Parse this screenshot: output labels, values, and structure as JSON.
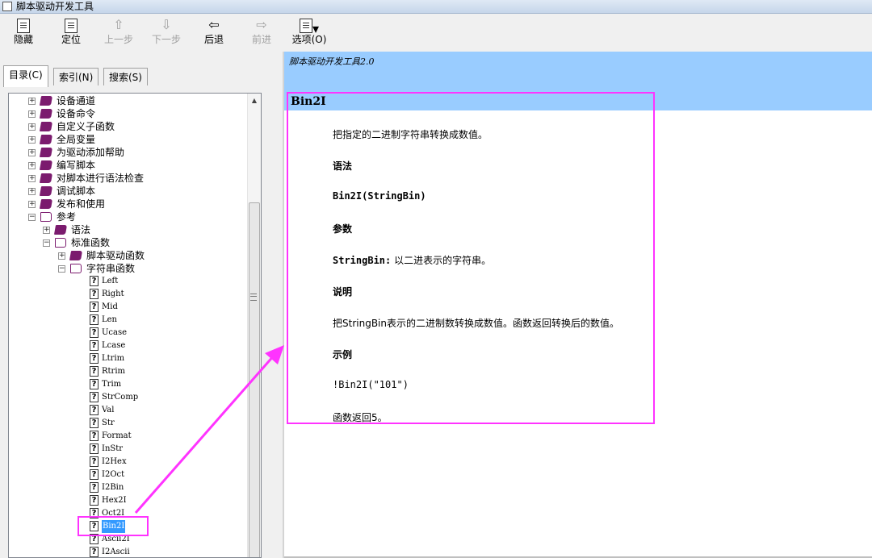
{
  "window": {
    "title": "脚本驱动开发工具"
  },
  "toolbar": [
    {
      "id": "hide",
      "label": "隐藏",
      "icon": "hide-icon",
      "enabled": true
    },
    {
      "id": "locate",
      "label": "定位",
      "icon": "locate-icon",
      "enabled": true
    },
    {
      "id": "prev",
      "label": "上一步",
      "icon": "up-arrow-icon",
      "enabled": false
    },
    {
      "id": "next",
      "label": "下一步",
      "icon": "down-arrow-icon",
      "enabled": false
    },
    {
      "id": "back",
      "label": "后退",
      "icon": "back-arrow-icon",
      "enabled": true
    },
    {
      "id": "forward",
      "label": "前进",
      "icon": "forward-arrow-icon",
      "enabled": false
    },
    {
      "id": "options",
      "label": "选项(O)",
      "icon": "options-icon",
      "enabled": true
    }
  ],
  "tabs": {
    "contents": "目录(C)",
    "index": "索引(N)",
    "search": "搜索(S)"
  },
  "tree": {
    "top": [
      "设备通道",
      "设备命令",
      "自定义子函数",
      "全局变量",
      "为驱动添加帮助",
      "编写脚本",
      "对脚本进行语法检查",
      "调试脚本",
      "发布和使用"
    ],
    "ref": "参考",
    "syntax": "语法",
    "stdfunc": "标准函数",
    "scriptfunc": "脚本驱动函数",
    "strfunc": "字符串函数",
    "items": [
      "Left",
      "Right",
      "Mid",
      "Len",
      "Ucase",
      "Lcase",
      "Ltrim",
      "Rtrim",
      "Trim",
      "StrComp",
      "Val",
      "Str",
      "Format",
      "InStr",
      "I2Hex",
      "I2Oct",
      "I2Bin",
      "Hex2I",
      "Oct2I",
      "Bin2I",
      "Ascii2I",
      "I2Ascii"
    ],
    "selected": "Bin2I"
  },
  "doc": {
    "breadcrumb": "脚本驱动开发工具2.0",
    "title": "Bin2I",
    "desc": "把指定的二进制字符串转换成数值。",
    "h_syntax": "语法",
    "syntax": "Bin2I(StringBin)",
    "h_params": "参数",
    "param_name": "StringBin:",
    "param_desc": " 以二进表示的字符串。",
    "h_notes": "说明",
    "notes": "把StringBin表示的二进制数转换成数值。函数返回转换后的数值。",
    "h_example": "示例",
    "example": "!Bin2I(\"101\")",
    "result": "函数返回5。"
  },
  "colors": {
    "highlight": "#ff33ff",
    "header": "#99ccff",
    "selection": "#3399ff"
  }
}
